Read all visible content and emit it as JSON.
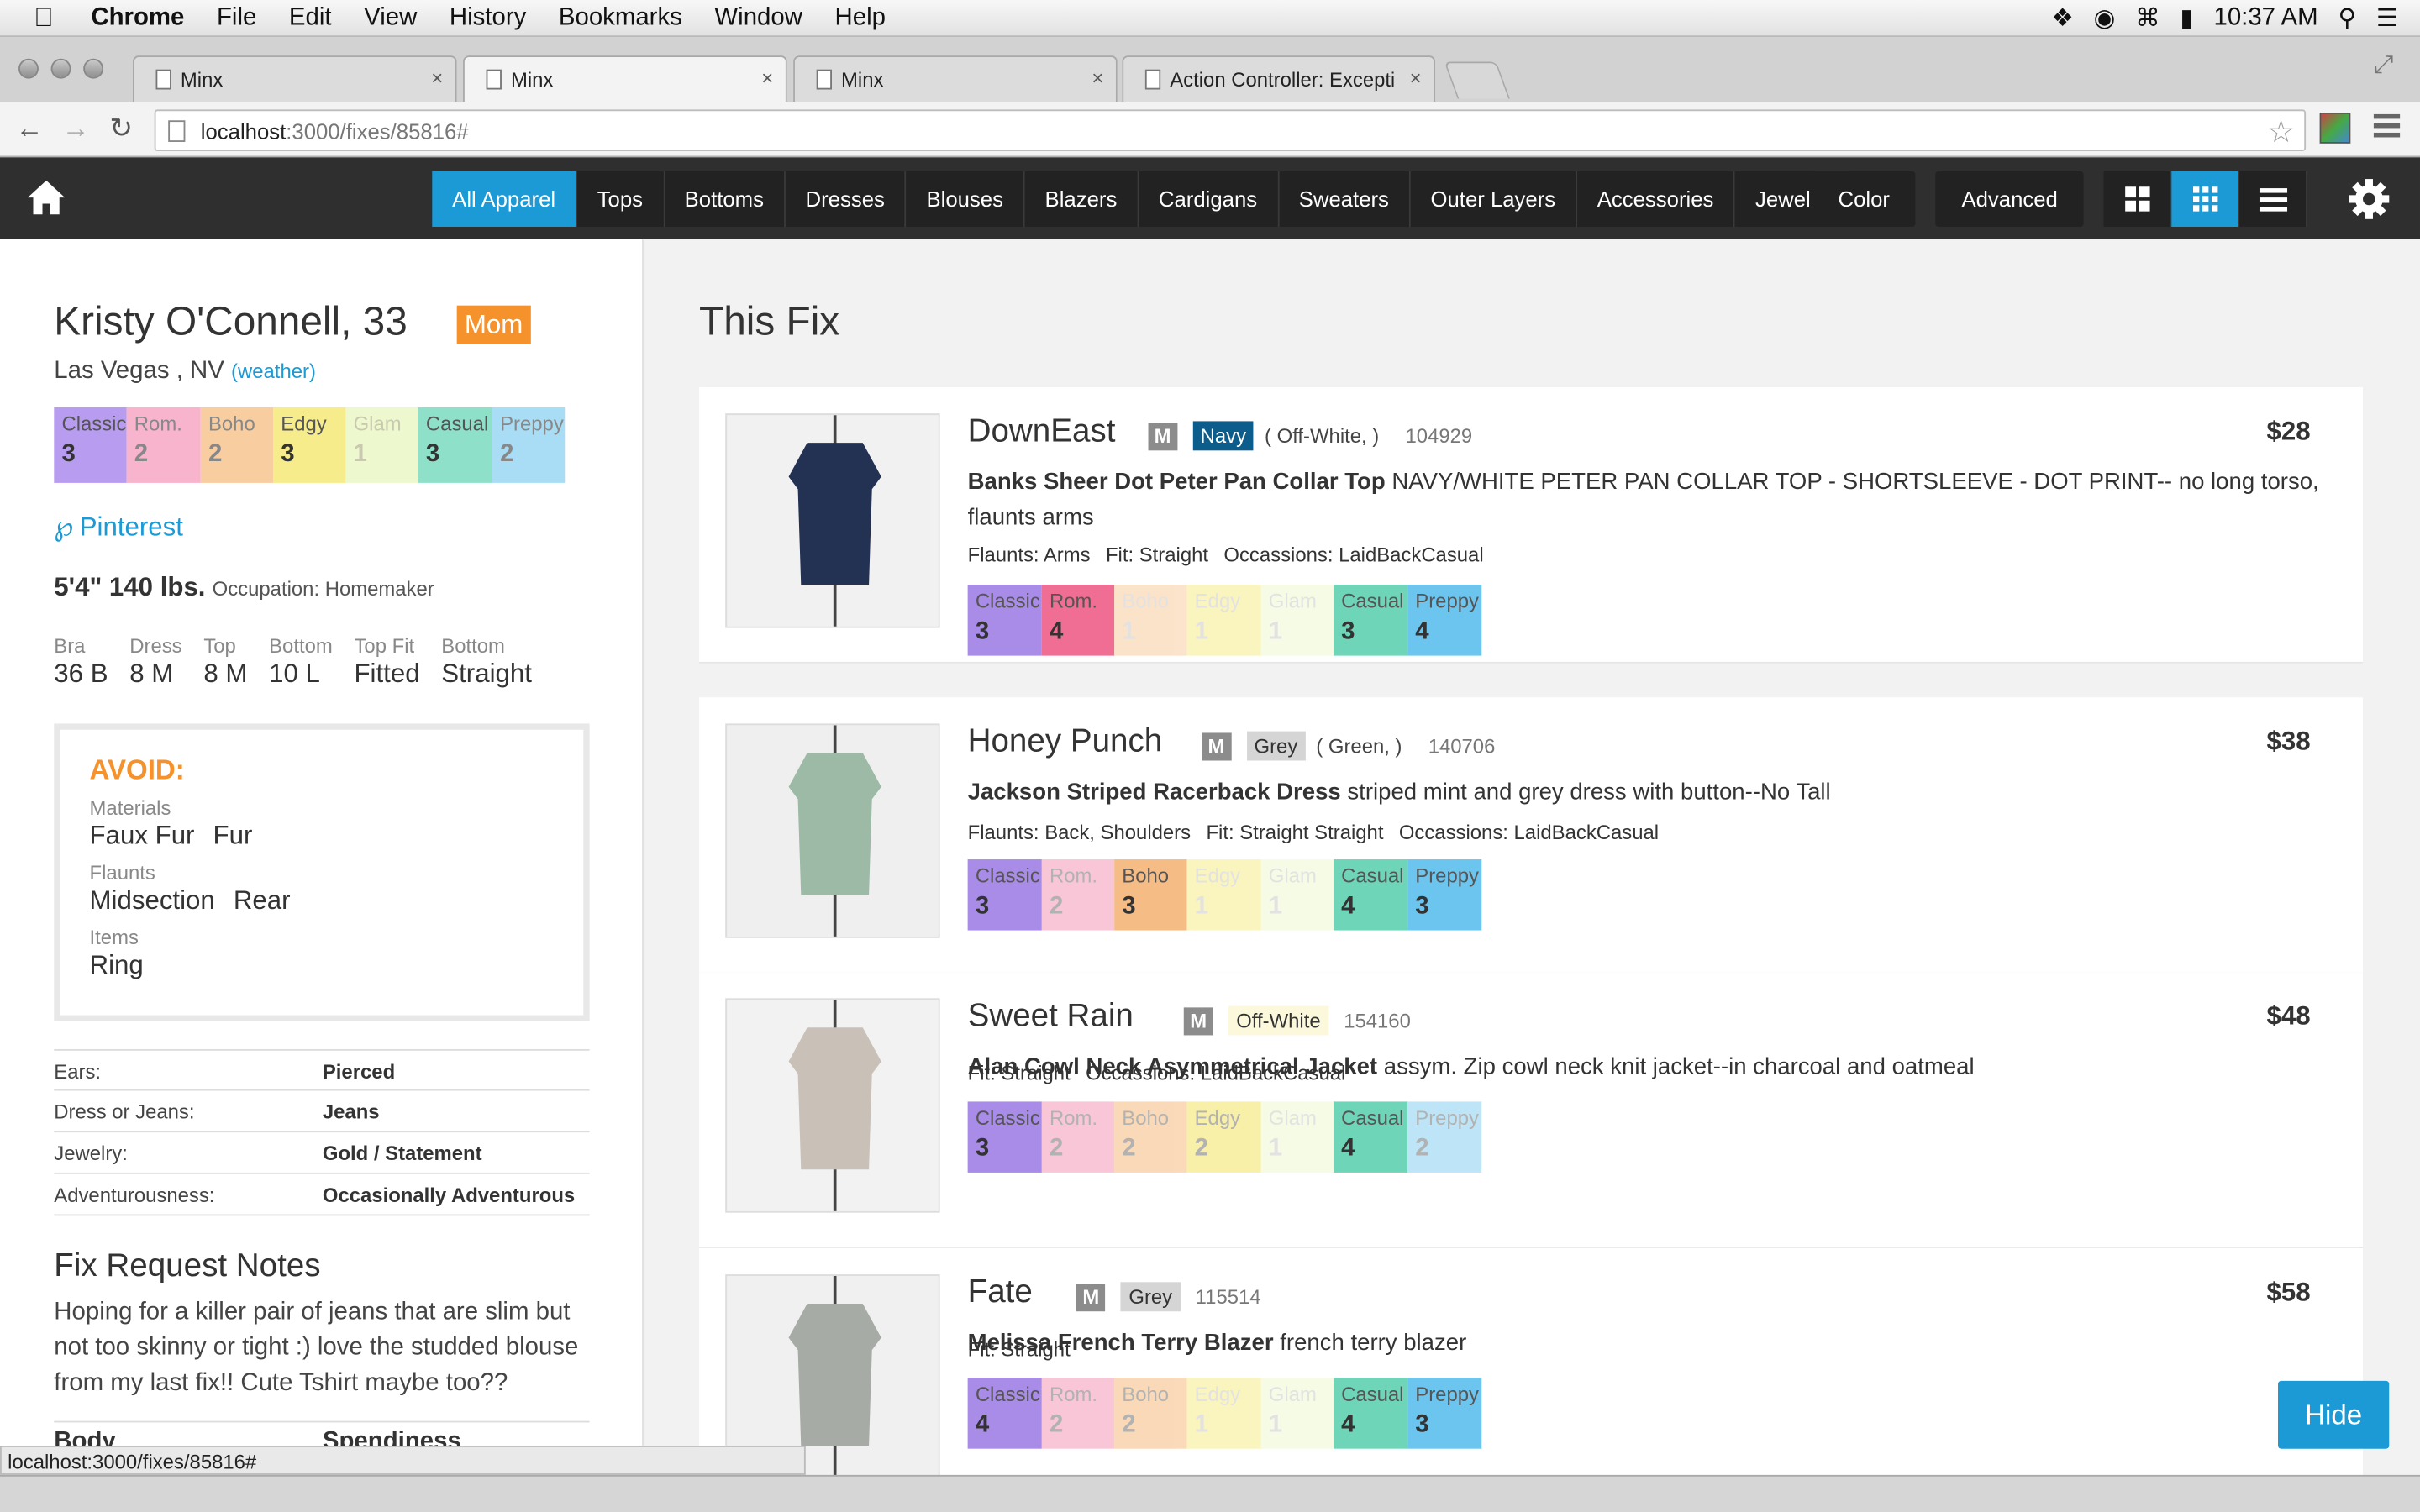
{
  "system_bar": {
    "app_name": "Chrome",
    "menus": [
      "File",
      "Edit",
      "View",
      "History",
      "Bookmarks",
      "Window",
      "Help"
    ],
    "clock": "10:37 AM"
  },
  "browser": {
    "tabs": [
      {
        "label": "Minx",
        "active": false
      },
      {
        "label": "Minx",
        "active": true
      },
      {
        "label": "Minx",
        "active": false
      },
      {
        "label": "Action Controller: Exceptio",
        "active": false
      }
    ],
    "url_host": "localhost",
    "url_path": ":3000/fixes/85816#",
    "status_url": "localhost:3000/fixes/85816#"
  },
  "nav": {
    "categories": [
      "All Apparel",
      "Tops",
      "Bottoms",
      "Dresses",
      "Blouses",
      "Blazers",
      "Cardigans",
      "Sweaters",
      "Outer Layers",
      "Accessories",
      "Jewelry"
    ],
    "active_category": "All Apparel",
    "color_btn": "Color",
    "advanced_btn": "Advanced",
    "active_view": "grid-small"
  },
  "style_colors": {
    "Classic": "#b79cf0",
    "Rom.": "#f7b4cc",
    "Boho": "#f8cda0",
    "Edgy": "#f6ec8c",
    "Glam": "#eef8cf",
    "Casual": "#8fe0c9",
    "Preppy": "#a9ddf5",
    "Classic_strong": "#a98be8",
    "Rom._strong": "#f06e93",
    "Boho_strong": "#f5bc86",
    "Casual_strong": "#6fd5b9",
    "Preppy_strong": "#6cc5ef",
    "accent": "#1c9ad6",
    "badge": "#f6922b"
  },
  "client": {
    "name": "Kristy O'Connell, 33",
    "badge": "Mom",
    "location": "Las Vegas , NV",
    "weather_link": "(weather)",
    "style_scores": [
      {
        "label": "Classic",
        "value": "3"
      },
      {
        "label": "Rom.",
        "value": "2"
      },
      {
        "label": "Boho",
        "value": "2"
      },
      {
        "label": "Edgy",
        "value": "3"
      },
      {
        "label": "Glam",
        "value": "1"
      },
      {
        "label": "Casual",
        "value": "3"
      },
      {
        "label": "Preppy",
        "value": "2"
      }
    ],
    "pinterest": "Pinterest",
    "height_weight": "5'4\" 140 lbs.",
    "occupation": "Occupation: Homemaker",
    "sizes": [
      {
        "label": "Bra",
        "value": "36 B"
      },
      {
        "label": "Dress",
        "value": "8 M"
      },
      {
        "label": "Top",
        "value": "8 M"
      },
      {
        "label": "Bottom",
        "value": "10 L"
      },
      {
        "label": "Top Fit",
        "value": "Fitted"
      },
      {
        "label": "Bottom",
        "value": "Straight"
      }
    ],
    "avoid": {
      "title": "AVOID:",
      "materials_label": "Materials",
      "materials": [
        "Faux Fur",
        "Fur"
      ],
      "flaunts_label": "Flaunts",
      "flaunts": [
        "Midsection",
        "Rear"
      ],
      "items_label": "Items",
      "items": [
        "Ring"
      ]
    },
    "prefs": [
      {
        "key": "Ears:",
        "value": "Pierced"
      },
      {
        "key": "Dress or Jeans:",
        "value": "Jeans"
      },
      {
        "key": "Jewelry:",
        "value": "Gold / Statement"
      },
      {
        "key": "Adventurousness:",
        "value": "Occasionally Adventurous"
      }
    ],
    "notes_title": "Fix Request Notes",
    "notes": "Hoping for a killer pair of jeans that are slim but not too skinny or tight :) love the studded blouse from my last fix!! Cute Tshirt maybe too??",
    "cut_labels": [
      "Body",
      "Spendiness"
    ]
  },
  "fix": {
    "title": "This Fix",
    "items": [
      {
        "brand": "DownEast",
        "size": "M",
        "color": "Navy",
        "color_bg": "#0d5d8c",
        "color_fg": "#ffffff",
        "alt_colors": "( Off-White, )",
        "sku": "104929",
        "price": "$28",
        "product": "Banks Sheer Dot Peter Pan Collar Top",
        "description": " NAVY/WHITE PETER PAN COLLAR TOP - SHORTSLEEVE - DOT PRINT-- no long torso, flaunts arms",
        "attrs": [
          "Flaunts: Arms",
          "Fit: Straight",
          "Occassions: LaidBackCasual"
        ],
        "scores": [
          {
            "label": "Classic",
            "value": "3",
            "strong": true
          },
          {
            "label": "Rom.",
            "value": "4",
            "strong": true
          },
          {
            "label": "Boho",
            "value": "1",
            "strong": false
          },
          {
            "label": "Edgy",
            "value": "1",
            "strong": false
          },
          {
            "label": "Glam",
            "value": "1",
            "strong": false
          },
          {
            "label": "Casual",
            "value": "3",
            "strong": true
          },
          {
            "label": "Preppy",
            "value": "4",
            "strong": true
          }
        ]
      },
      {
        "brand": "Honey Punch",
        "size": "M",
        "color": "Grey",
        "color_bg": "#d5d5d5",
        "color_fg": "#333333",
        "alt_colors": "( Green, )",
        "sku": "140706",
        "price": "$38",
        "product": "Jackson Striped Racerback Dress",
        "description": " striped mint and grey dress with button--No Tall",
        "attrs": [
          "Flaunts: Back, Shoulders",
          "Fit: Straight Straight",
          "Occassions: LaidBackCasual"
        ],
        "scores": [
          {
            "label": "Classic",
            "value": "3",
            "strong": true
          },
          {
            "label": "Rom.",
            "value": "2",
            "strong": false
          },
          {
            "label": "Boho",
            "value": "3",
            "strong": true
          },
          {
            "label": "Edgy",
            "value": "1",
            "strong": false
          },
          {
            "label": "Glam",
            "value": "1",
            "strong": false
          },
          {
            "label": "Casual",
            "value": "4",
            "strong": true
          },
          {
            "label": "Preppy",
            "value": "3",
            "strong": true
          }
        ]
      },
      {
        "brand": "Sweet Rain",
        "size": "M",
        "color": "Off-White",
        "color_bg": "#fbf8dc",
        "color_fg": "#333333",
        "alt_colors": "",
        "sku": "154160",
        "price": "$48",
        "product": "Alan Cowl Neck Asymmetrical Jacket",
        "description": " assym. Zip cowl neck knit jacket--in charcoal and oatmeal",
        "attrs": [
          "Fit: Straight",
          "Occassions: LaidBackCasual"
        ],
        "scores": [
          {
            "label": "Classic",
            "value": "3",
            "strong": true
          },
          {
            "label": "Rom.",
            "value": "2",
            "strong": false
          },
          {
            "label": "Boho",
            "value": "2",
            "strong": false
          },
          {
            "label": "Edgy",
            "value": "2",
            "strong": false
          },
          {
            "label": "Glam",
            "value": "1",
            "strong": false
          },
          {
            "label": "Casual",
            "value": "4",
            "strong": true
          },
          {
            "label": "Preppy",
            "value": "2",
            "strong": false
          }
        ]
      },
      {
        "brand": "Fate",
        "size": "M",
        "color": "Grey",
        "color_bg": "#d5d5d5",
        "color_fg": "#333333",
        "alt_colors": "",
        "sku": "115514",
        "price": "$58",
        "product": "Melissa French Terry Blazer",
        "description": " french terry blazer",
        "attrs": [
          "Fit: Straight"
        ],
        "scores": [
          {
            "label": "Classic",
            "value": "4",
            "strong": true
          },
          {
            "label": "Rom.",
            "value": "2",
            "strong": false
          },
          {
            "label": "Boho",
            "value": "2",
            "strong": false
          },
          {
            "label": "Edgy",
            "value": "1",
            "strong": false
          },
          {
            "label": "Glam",
            "value": "1",
            "strong": false
          },
          {
            "label": "Casual",
            "value": "4",
            "strong": true
          },
          {
            "label": "Preppy",
            "value": "3",
            "strong": true
          }
        ]
      }
    ]
  },
  "hide_button": "Hide"
}
